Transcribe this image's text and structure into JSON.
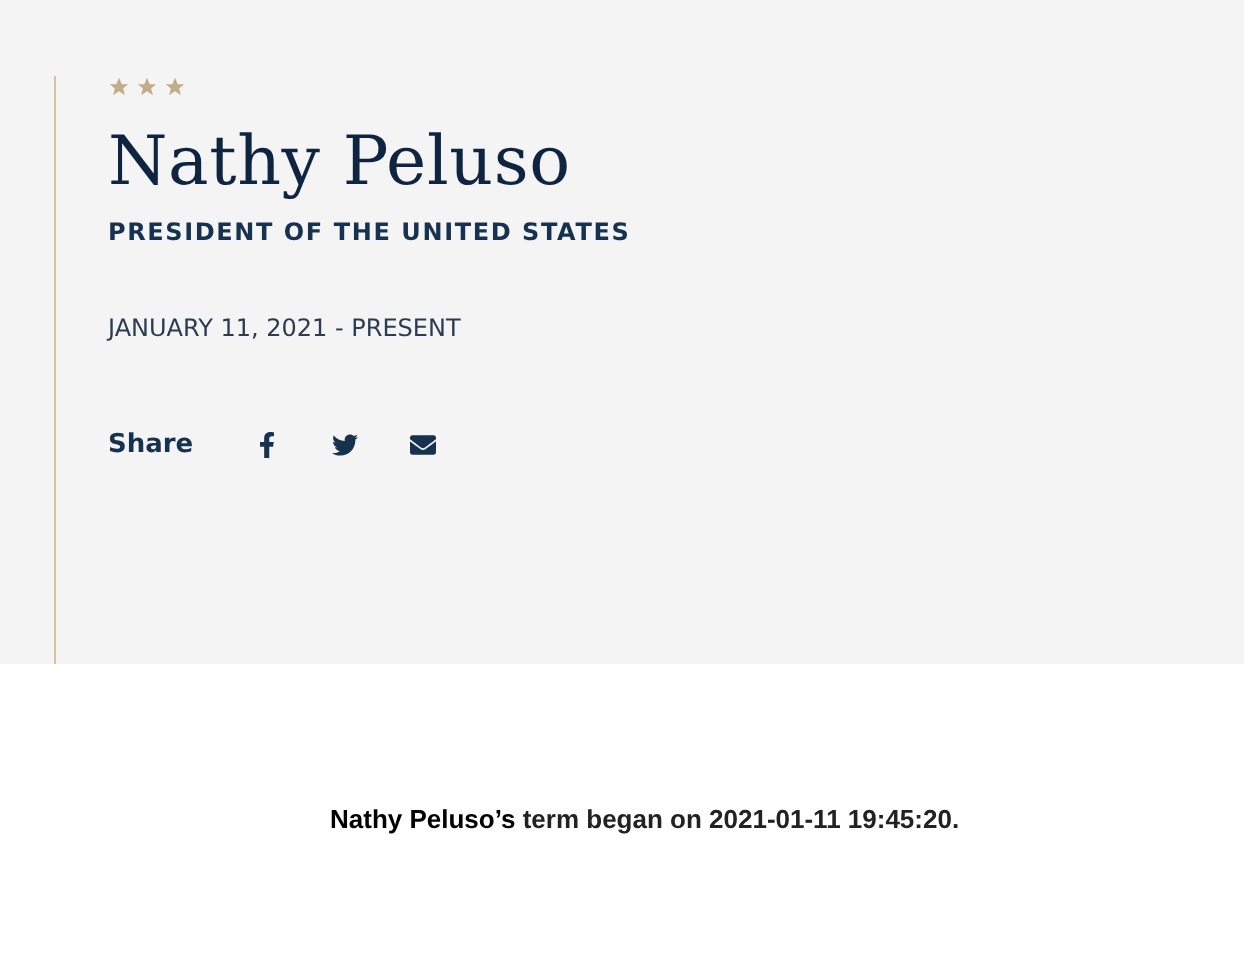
{
  "profile": {
    "name": "Nathy Peluso",
    "title": "PRESIDENT OF THE UNITED STATES",
    "term": "JANUARY 11, 2021 - PRESENT"
  },
  "share": {
    "label": "Share",
    "links": [
      {
        "kind": "facebook"
      },
      {
        "kind": "twitter"
      },
      {
        "kind": "email"
      }
    ]
  },
  "caption": {
    "name": "Nathy Peluso’s",
    "rest": "term began on 2021-01-11 19:45:20."
  }
}
